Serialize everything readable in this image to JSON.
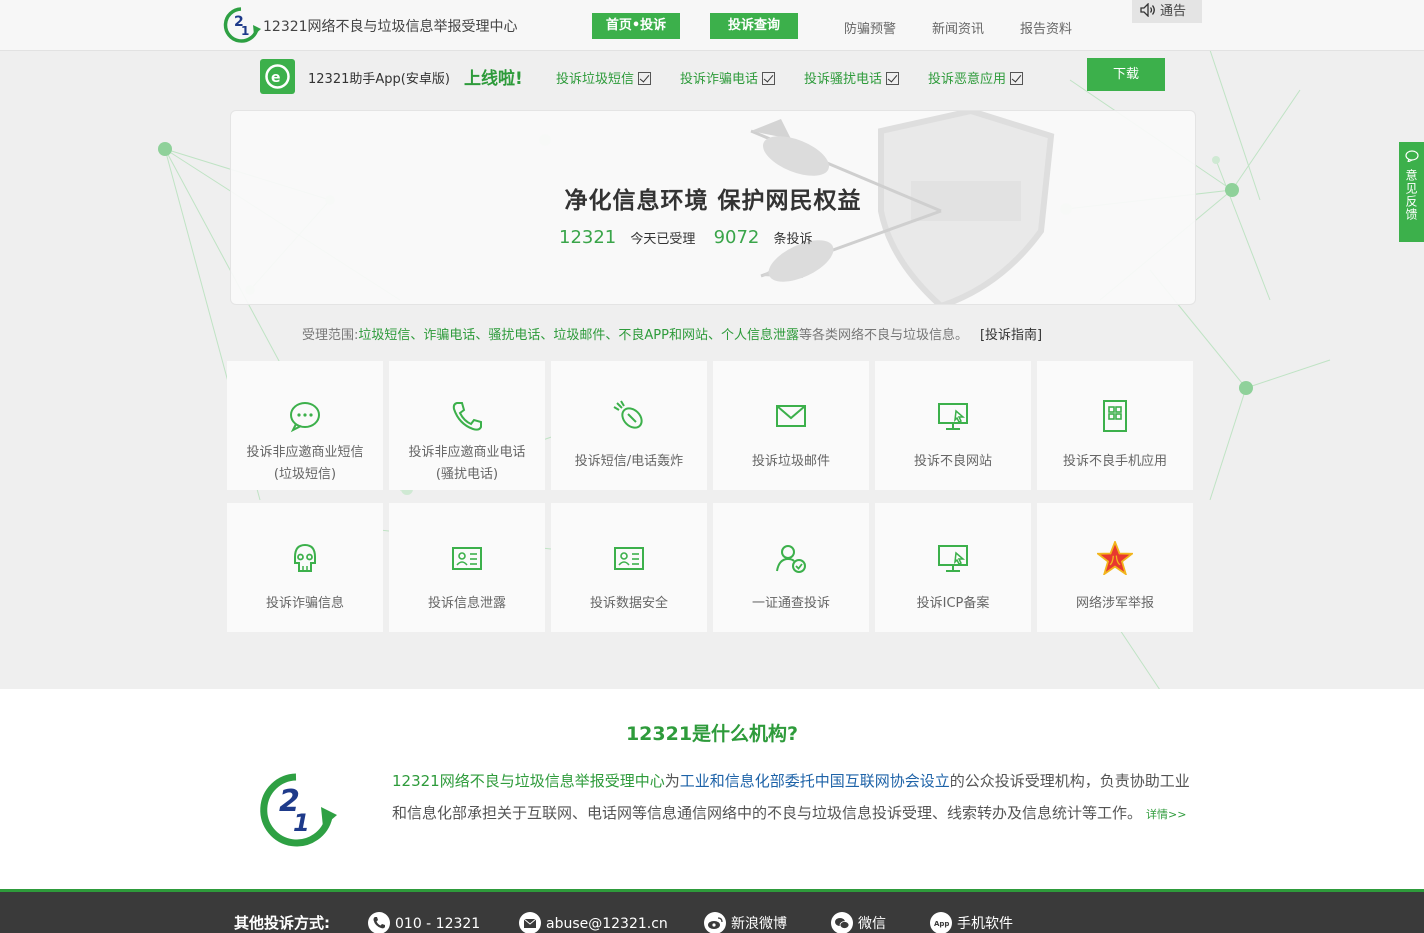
{
  "header": {
    "site_title": "12321网络不良与垃圾信息举报受理中心",
    "nav_primary": [
      "首页•投诉",
      "投诉查询"
    ],
    "nav_links": [
      "防骗预警",
      "新闻资讯",
      "报告资料"
    ],
    "notice": "通告"
  },
  "app_banner": {
    "text": "12321助手App(安卓版)",
    "live": "上线啦!",
    "items": [
      "投诉垃圾短信",
      "投诉诈骗电话",
      "投诉骚扰电话",
      "投诉恶意应用"
    ],
    "download": "下载"
  },
  "hero": {
    "slogan": "净化信息环境 保护网民权益",
    "stats_number": "12321",
    "stats_label_1": "今天已受理",
    "stats_count": "9072",
    "stats_label_2": "条投诉"
  },
  "scope": {
    "prefix": "受理范围:",
    "items": "垃圾短信、诈骗电话、骚扰电话、垃圾邮件、不良APP和网站、个人信息泄露",
    "suffix": "等各类网络不良与垃圾信息。",
    "guide": "[投诉指南]"
  },
  "cards": [
    {
      "line1": "投诉非应邀商业短信",
      "line2": "(垃圾短信)",
      "icon": "chat-icon"
    },
    {
      "line1": "投诉非应邀商业电话",
      "line2": "(骚扰电话)",
      "icon": "phone-icon"
    },
    {
      "line1": "投诉短信/电话轰炸",
      "line2": "",
      "icon": "bomb-icon"
    },
    {
      "line1": "投诉垃圾邮件",
      "line2": "",
      "icon": "mail-icon"
    },
    {
      "line1": "投诉不良网站",
      "line2": "",
      "icon": "monitor-icon"
    },
    {
      "line1": "投诉不良手机应用",
      "line2": "",
      "icon": "app-icon"
    },
    {
      "line1": "投诉诈骗信息",
      "line2": "",
      "icon": "skull-icon"
    },
    {
      "line1": "投诉信息泄露",
      "line2": "",
      "icon": "id-card-icon"
    },
    {
      "line1": "投诉数据安全",
      "line2": "",
      "icon": "id-card-icon"
    },
    {
      "line1": "一证通查投诉",
      "line2": "",
      "icon": "user-check-icon"
    },
    {
      "line1": "投诉ICP备案",
      "line2": "",
      "icon": "monitor-icon"
    },
    {
      "line1": "网络涉军举报",
      "line2": "",
      "icon": "army-star-icon"
    }
  ],
  "about": {
    "title": "12321是什么机构?",
    "text_g": "12321网络不良与垃圾信息举报受理中心",
    "text_1": "为",
    "text_b": "工业和信息化部委托中国互联网协会设立",
    "text_2": "的公众投诉受理机构，负责协助工业和信息化部承担关于互联网、电话网等信息通信网络中的不良与垃圾信息投诉受理、线索转办及信息统计等工作。",
    "more": "详情>>"
  },
  "footer": {
    "label": "其他投诉方式:",
    "phone": "010 - 12321",
    "email": "abuse@12321.cn",
    "weibo": "新浪微博",
    "wechat": "微信",
    "app": "手机软件"
  },
  "feedback": {
    "label": "意见反馈"
  },
  "colors": {
    "brand_green": "#3cb04b",
    "text_green": "#2e9b3b",
    "link_blue": "#1e63a8",
    "footer_bg": "#3a3a3a"
  }
}
